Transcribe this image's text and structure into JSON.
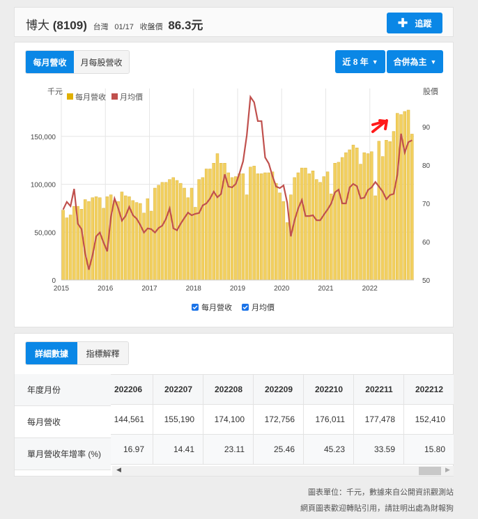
{
  "header": {
    "name": "博大",
    "code": "(8109)",
    "market": "台灣",
    "date": "01/17",
    "close_label": "收盤價",
    "close": "86.3元",
    "follow_label": "追蹤"
  },
  "chart_tabs": [
    "每月營收",
    "月每股營收"
  ],
  "range_label": "近 8 年",
  "basis_label": "合併為主",
  "colors": {
    "accent": "#0a87e6",
    "bar": "#f2d060",
    "line": "#c0504d",
    "annotation": "#ff1a1a"
  },
  "chart_data": {
    "type": "bar+line",
    "left_axis_label": "千元",
    "right_axis_label": "股價",
    "left_ticks": [
      "0",
      "50,000",
      "100,000",
      "150,000"
    ],
    "left_tick_values": [
      0,
      50000,
      100000,
      150000
    ],
    "ylim_left": [
      0,
      200000
    ],
    "right_ticks": [
      "50",
      "60",
      "70",
      "80",
      "90"
    ],
    "right_tick_values": [
      50,
      60,
      70,
      80,
      90
    ],
    "ylim_right": [
      50,
      100
    ],
    "x_ticks": [
      "2015",
      "2016",
      "2017",
      "2018",
      "2019",
      "2020",
      "2021",
      "2022"
    ],
    "legend": [
      "每月營收",
      "月均價"
    ],
    "series": [
      {
        "name": "每月營收",
        "type": "bar",
        "values": [
          73000,
          65000,
          68000,
          77000,
          77000,
          74000,
          84000,
          82000,
          86000,
          87000,
          86000,
          75000,
          87000,
          89000,
          83000,
          82000,
          92000,
          88000,
          87000,
          83000,
          81000,
          80000,
          70000,
          85000,
          72000,
          96000,
          99000,
          102000,
          102000,
          105000,
          107000,
          104000,
          101000,
          96000,
          86000,
          96000,
          76000,
          105000,
          107000,
          116000,
          116000,
          122000,
          132000,
          122000,
          122000,
          112000,
          107000,
          108000,
          111000,
          111000,
          89000,
          118000,
          119000,
          111000,
          111000,
          112000,
          112000,
          113000,
          101000,
          91000,
          82000,
          60000,
          89000,
          107000,
          112000,
          117000,
          117000,
          111000,
          114000,
          105000,
          102000,
          108000,
          113000,
          90000,
          122000,
          123000,
          128000,
          133000,
          136000,
          141000,
          138000,
          121000,
          133000,
          132000,
          134000,
          88000,
          145000,
          129000,
          146000,
          144561,
          155190,
          174100,
          172756,
          176011,
          177478,
          152410
        ]
      },
      {
        "name": "月均價",
        "type": "line",
        "values": [
          68.4,
          70.4,
          69.3,
          73.8,
          64.7,
          63.3,
          56.9,
          52.7,
          56.5,
          61.4,
          62.4,
          59.8,
          57.5,
          66.5,
          71.3,
          68.7,
          65.5,
          66.7,
          69.1,
          66.9,
          66,
          64.4,
          62.4,
          63.5,
          63.3,
          62.4,
          63.6,
          64.2,
          66,
          68.7,
          63.5,
          63,
          64.7,
          66.2,
          67.6,
          66.9,
          67.3,
          67.5,
          69.5,
          70,
          71.3,
          73.1,
          71.6,
          72.5,
          77.6,
          74.4,
          74.2,
          75.1,
          77.8,
          81,
          87.8,
          97.8,
          96.4,
          91.5,
          91.5,
          82,
          80.4,
          77.1,
          74.4,
          74,
          74.7,
          70.2,
          61.4,
          65.6,
          68.7,
          70.9,
          66.7,
          66.7,
          66.9,
          65.6,
          65.6,
          67.1,
          68.4,
          70,
          72.9,
          73.6,
          70,
          70,
          74.2,
          75.1,
          74.5,
          71.3,
          71.5,
          73.5,
          74.2,
          75.6,
          74.4,
          73.1,
          71.1,
          72.2,
          72.5,
          77.5,
          88.2,
          83.3,
          86,
          86.5
        ]
      }
    ]
  },
  "table_tabs": [
    "詳細數據",
    "指標解釋"
  ],
  "table": {
    "row_labels": [
      "年度月份",
      "每月營收",
      "單月營收年增率 (%)"
    ],
    "columns": [
      "202206",
      "202207",
      "202208",
      "202209",
      "202210",
      "202211",
      "202212"
    ],
    "revenue": [
      "144,561",
      "155,190",
      "174,100",
      "172,756",
      "176,011",
      "177,478",
      "152,410"
    ],
    "yoy": [
      "16.97",
      "14.41",
      "23.11",
      "25.46",
      "45.23",
      "33.59",
      "15.80"
    ]
  },
  "footer": [
    "圖表單位：千元，數據來自公開資訊觀測站",
    "網頁圖表歡迎轉貼引用，請註明出處為財報狗"
  ]
}
